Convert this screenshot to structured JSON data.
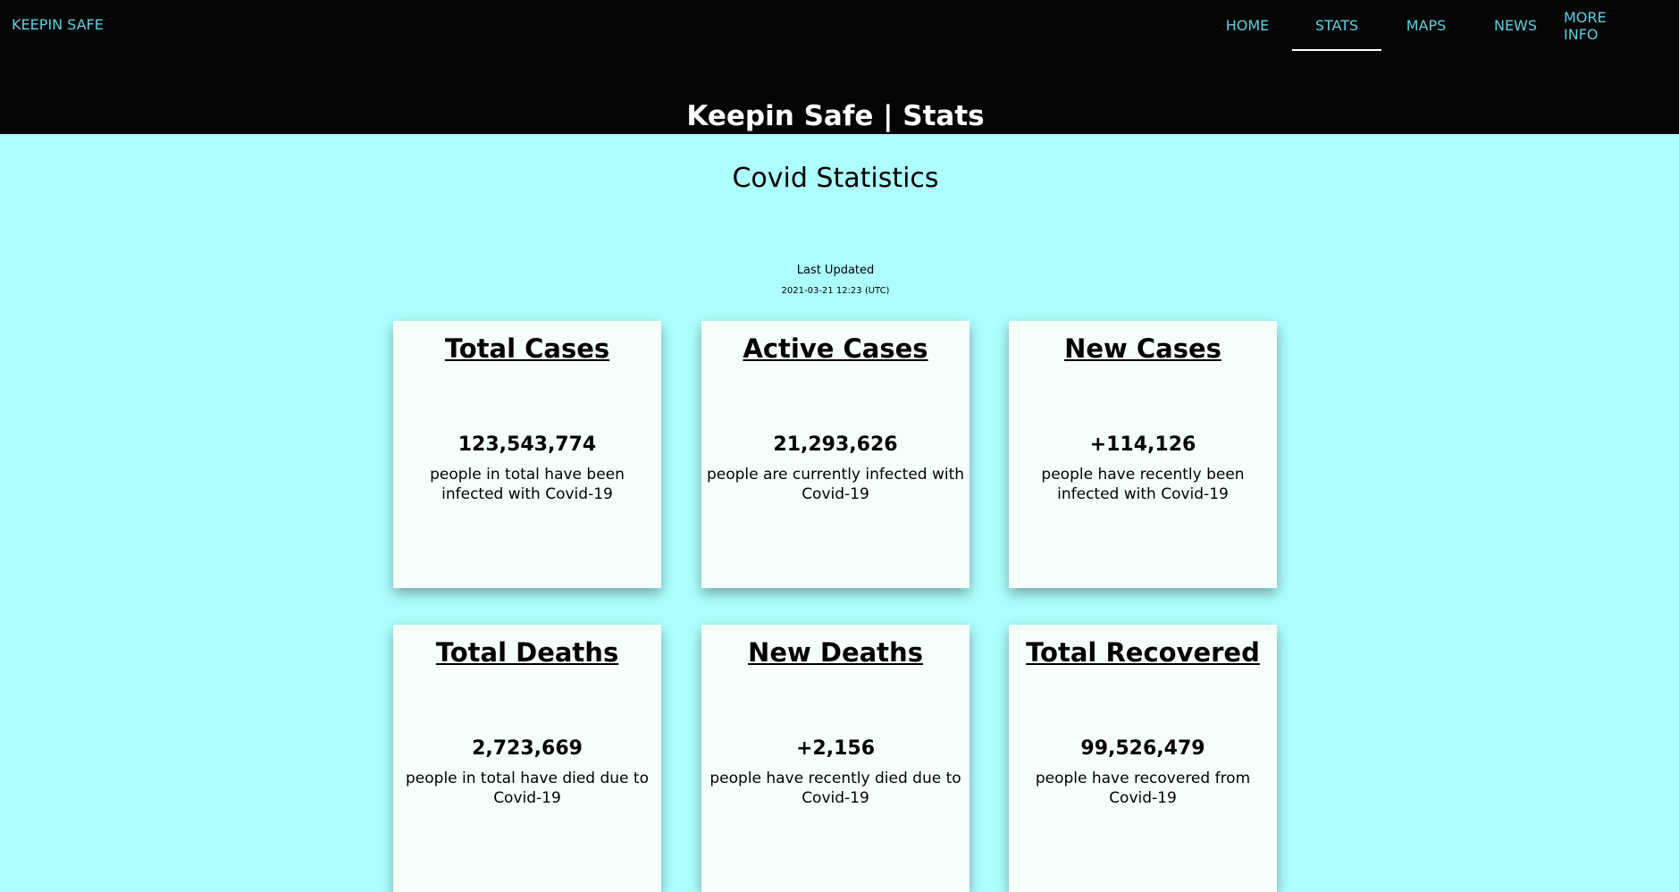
{
  "header": {
    "brand": "KEEPIN SAFE",
    "nav": [
      {
        "label": "HOME"
      },
      {
        "label": "STATS"
      },
      {
        "label": "MAPS"
      },
      {
        "label": "NEWS"
      },
      {
        "label": "MORE INFO"
      }
    ],
    "active_nav": "STATS",
    "site_title": "Keepin Safe | Stats"
  },
  "main": {
    "heading": "Covid Statistics",
    "last_updated_label": "Last Updated",
    "last_updated_value": "2021-03-21 12:23 (UTC)",
    "cards": [
      {
        "title": "Total Cases",
        "value": "123,543,774",
        "description": "people in total have been infected with Covid-19"
      },
      {
        "title": "Active Cases",
        "value": "21,293,626",
        "description": "people are currently infected with Covid-19"
      },
      {
        "title": "New Cases",
        "value": "+114,126",
        "description": "people have recently been infected with Covid-19"
      },
      {
        "title": "Total Deaths",
        "value": "2,723,669",
        "description": "people in total have died due to Covid-19"
      },
      {
        "title": "New Deaths",
        "value": "+2,156",
        "description": "people have recently died due to Covid-19"
      },
      {
        "title": "Total Recovered",
        "value": "99,526,479",
        "description": "people have recovered from Covid-19"
      }
    ]
  },
  "colors": {
    "header_bg": "#050505",
    "page_bg": "#adffff",
    "card_bg": "#f5fffa",
    "nav_text": "#5fd0e0"
  }
}
